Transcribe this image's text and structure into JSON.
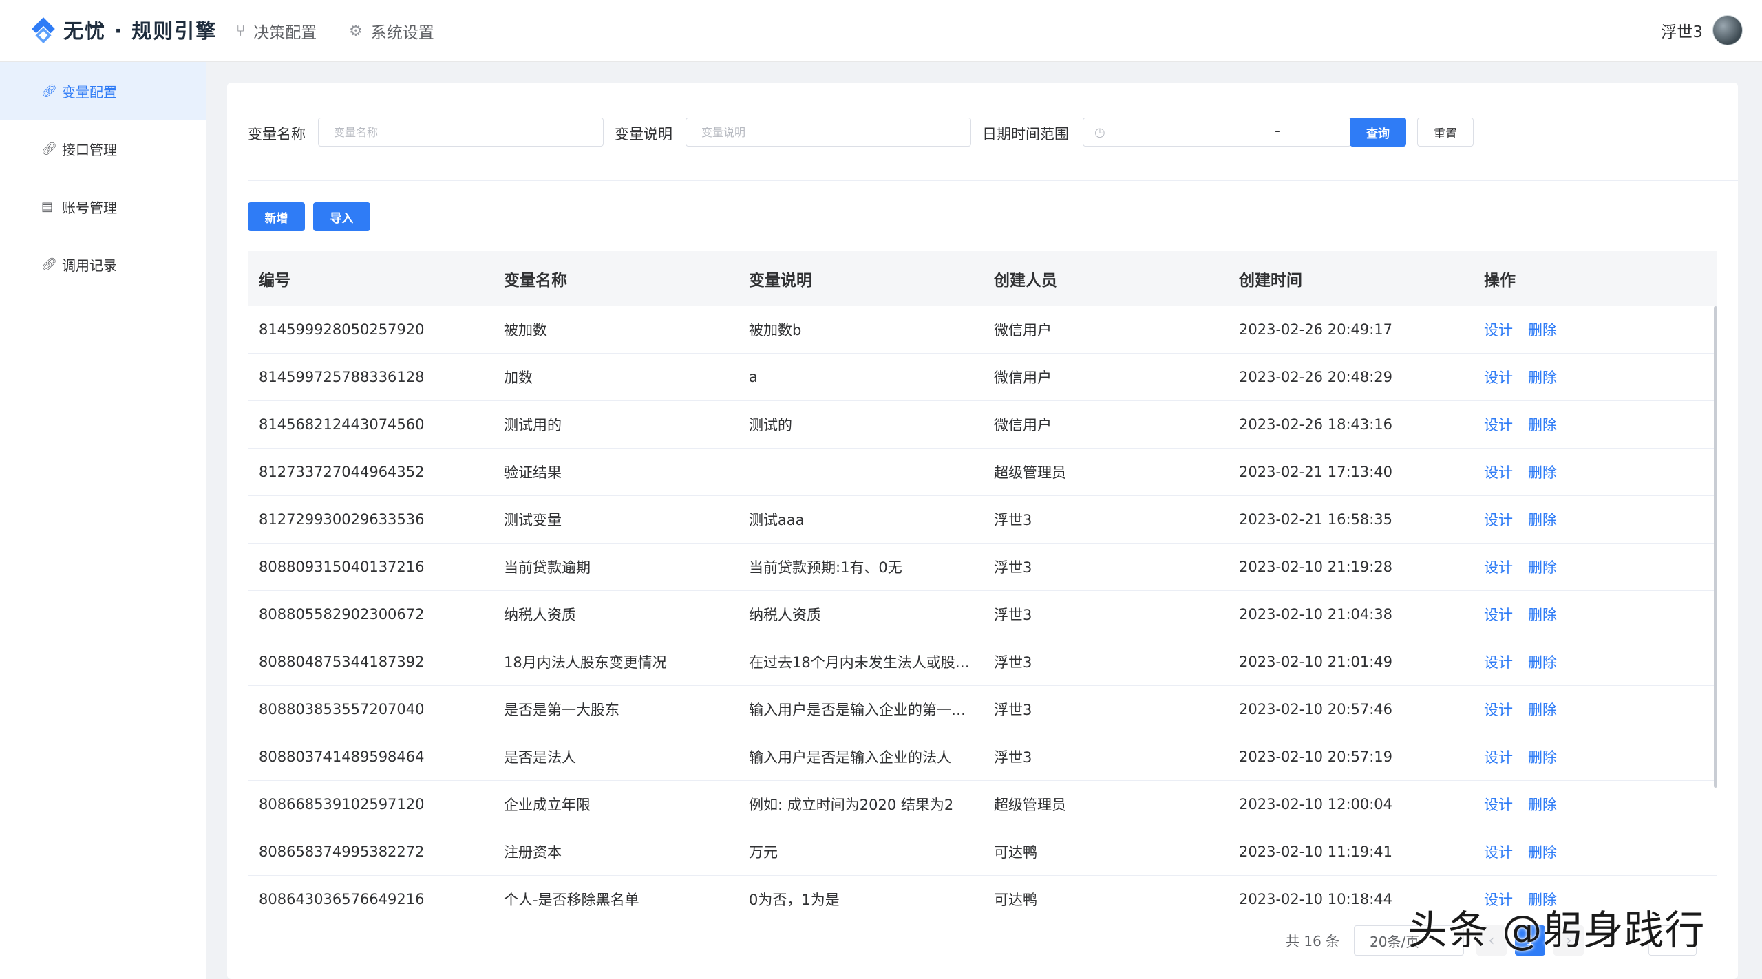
{
  "header": {
    "brand": "无忧 · 规则引擎",
    "nav": [
      {
        "label": "决策配置",
        "icon": "branch-icon"
      },
      {
        "label": "系统设置",
        "icon": "gear-icon"
      }
    ],
    "user_name": "浮世3"
  },
  "sidebar": {
    "items": [
      {
        "label": "变量配置",
        "icon": "link-icon",
        "active": true
      },
      {
        "label": "接口管理",
        "icon": "link-icon",
        "active": false
      },
      {
        "label": "账号管理",
        "icon": "list-icon",
        "active": false
      },
      {
        "label": "调用记录",
        "icon": "link-icon",
        "active": false
      }
    ]
  },
  "filters": {
    "var_name_label": "变量名称",
    "var_name_placeholder": "变量名称",
    "var_desc_label": "变量说明",
    "var_desc_placeholder": "变量说明",
    "date_label": "日期时间范围",
    "date_separator": "-",
    "query_button": "查询",
    "reset_button": "重置"
  },
  "actions": {
    "add_button": "新增",
    "import_button": "导入"
  },
  "table": {
    "columns": [
      "编号",
      "变量名称",
      "变量说明",
      "创建人员",
      "创建时间",
      "操作"
    ],
    "design_label": "设计",
    "delete_label": "删除",
    "rows": [
      {
        "id": "814599928050257920",
        "name": "被加数",
        "desc": "被加数b",
        "creator": "微信用户",
        "time": "2023-02-26 20:49:17"
      },
      {
        "id": "814599725788336128",
        "name": "加数",
        "desc": "a",
        "creator": "微信用户",
        "time": "2023-02-26 20:48:29"
      },
      {
        "id": "814568212443074560",
        "name": "测试用的",
        "desc": "测试的",
        "creator": "微信用户",
        "time": "2023-02-26 18:43:16"
      },
      {
        "id": "812733727044964352",
        "name": "验证结果",
        "desc": "",
        "creator": "超级管理员",
        "time": "2023-02-21 17:13:40"
      },
      {
        "id": "812729930029633536",
        "name": "测试变量",
        "desc": "测试aaa",
        "creator": "浮世3",
        "time": "2023-02-21 16:58:35"
      },
      {
        "id": "808809315040137216",
        "name": "当前贷款逾期",
        "desc": "当前贷款预期:1有、0无",
        "creator": "浮世3",
        "time": "2023-02-10 21:19:28"
      },
      {
        "id": "808805582902300672",
        "name": "纳税人资质",
        "desc": "纳税人资质",
        "creator": "浮世3",
        "time": "2023-02-10 21:04:38"
      },
      {
        "id": "808804875344187392",
        "name": "18月内法人股东变更情况",
        "desc": "在过去18个月内未发生法人或股…",
        "creator": "浮世3",
        "time": "2023-02-10 21:01:49"
      },
      {
        "id": "808803853557207040",
        "name": "是否是第一大股东",
        "desc": "输入用户是否是输入企业的第一…",
        "creator": "浮世3",
        "time": "2023-02-10 20:57:46"
      },
      {
        "id": "808803741489598464",
        "name": "是否是法人",
        "desc": "输入用户是否是输入企业的法人",
        "creator": "浮世3",
        "time": "2023-02-10 20:57:19"
      },
      {
        "id": "808668539102597120",
        "name": "企业成立年限",
        "desc": "例如: 成立时间为2020 结果为2",
        "creator": "超级管理员",
        "time": "2023-02-10 12:00:04"
      },
      {
        "id": "808658374995382272",
        "name": "注册资本",
        "desc": "万元",
        "creator": "可达鸭",
        "time": "2023-02-10 11:19:41"
      },
      {
        "id": "808643036576649216",
        "name": "个人-是否移除黑名单",
        "desc": "0为否，1为是",
        "creator": "可达鸭",
        "time": "2023-02-10 10:18:44"
      }
    ]
  },
  "pagination": {
    "total": "共 16 条",
    "page_size": "20条/页",
    "current_page": "1"
  },
  "watermark": "头条 @躬身践行",
  "colors": {
    "primary": "#2f7cf6",
    "sidebar_active_bg": "#e8f1fd"
  }
}
